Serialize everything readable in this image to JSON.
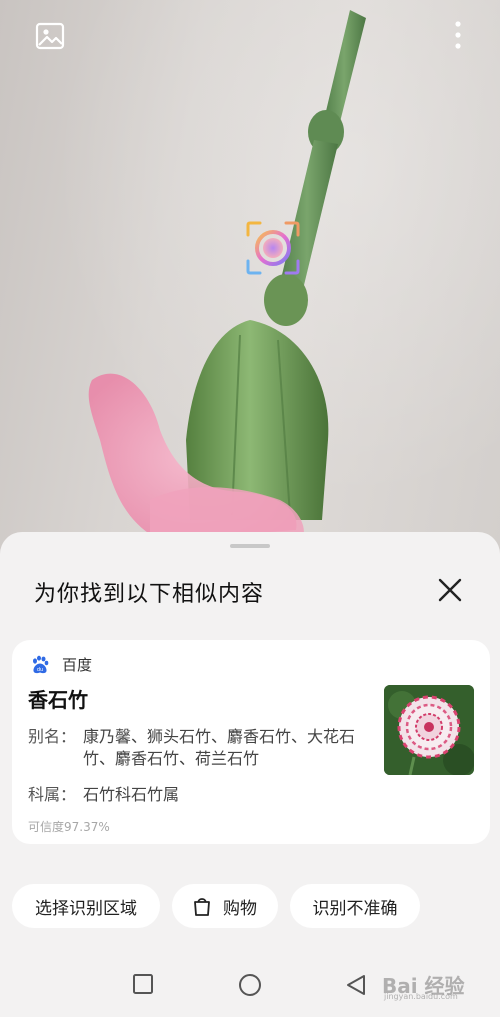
{
  "sheet": {
    "title": "为你找到以下相似内容"
  },
  "result": {
    "source": "百度",
    "name": "香石竹",
    "alias_label": "别名：",
    "alias_value": "康乃馨、狮头石竹、麝香石竹、大花石竹、麝香石竹、荷兰石竹",
    "family_label": "科属：",
    "family_value": "石竹科石竹属",
    "confidence": "可信度97.37%"
  },
  "actions": {
    "select_region": "选择识别区域",
    "shopping": "购物",
    "inaccurate": "识别不准确"
  },
  "watermark": {
    "text": "Bai 经验",
    "sub": "jingyan.baidu.com"
  },
  "colors": {
    "sheet_bg": "#f3f2f2",
    "card_bg": "#ffffff",
    "baidu_blue": "#2f6ae5"
  },
  "icons": {
    "gallery": "gallery-icon",
    "more": "more-vertical-icon",
    "focus": "ai-lens-icon",
    "close": "close-icon",
    "baidu": "baidu-paw-icon",
    "bag": "shopping-bag-icon"
  }
}
